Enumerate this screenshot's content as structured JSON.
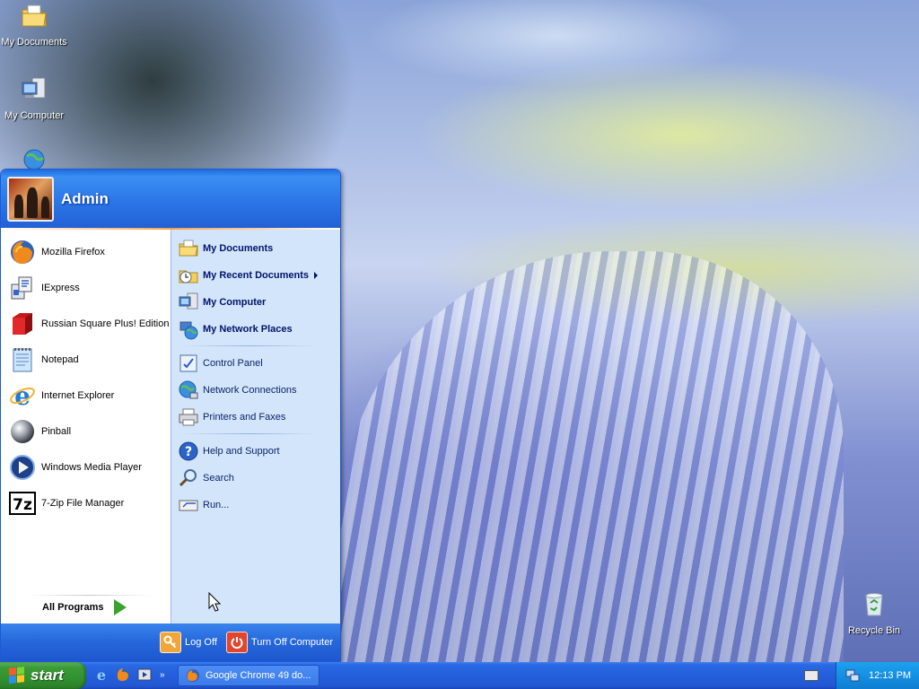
{
  "desktop": {
    "icons": [
      {
        "label": "My Documents"
      },
      {
        "label": "My Computer"
      },
      {
        "label": "Recycle Bin"
      }
    ]
  },
  "start_menu": {
    "user": "Admin",
    "left_items": [
      {
        "label": "Mozilla Firefox",
        "icon": "firefox-icon"
      },
      {
        "label": "IExpress",
        "icon": "iexpress-icon"
      },
      {
        "label": "Russian Square Plus! Edition",
        "icon": "russian-square-icon"
      },
      {
        "label": "Notepad",
        "icon": "notepad-icon"
      },
      {
        "label": "Internet Explorer",
        "icon": "internet-explorer-icon"
      },
      {
        "label": "Pinball",
        "icon": "pinball-icon"
      },
      {
        "label": "Windows Media Player",
        "icon": "media-player-icon"
      },
      {
        "label": "7-Zip File Manager",
        "icon": "7zip-icon"
      }
    ],
    "all_programs": "All Programs",
    "right_items": [
      {
        "label": "My Documents"
      },
      {
        "label": "My Recent Documents"
      },
      {
        "label": "My Computer"
      },
      {
        "label": "My Network Places"
      },
      {
        "label": "Control Panel"
      },
      {
        "label": "Network Connections"
      },
      {
        "label": "Printers and Faxes"
      },
      {
        "label": "Help and Support"
      },
      {
        "label": "Search"
      },
      {
        "label": "Run..."
      }
    ],
    "footer": {
      "log_off": "Log Off",
      "turn_off": "Turn Off Computer"
    }
  },
  "taskbar": {
    "start_label": "start",
    "task_window": "Google Chrome 49 do...",
    "clock": "12:13 PM"
  },
  "colors": {
    "taskbar_blue": "#245edb",
    "start_green": "#3c9b37",
    "tray_blue": "#1590e2",
    "right_pane": "#d3e5fa"
  }
}
